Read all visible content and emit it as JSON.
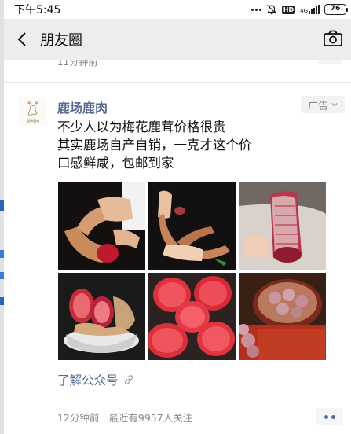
{
  "status_bar": {
    "time": "下午5:45",
    "hd": "HD",
    "network": "4G",
    "battery": "76"
  },
  "nav": {
    "title": "朋友圈",
    "back_icon": "chevron-left-icon",
    "camera_icon": "camera-icon"
  },
  "previous_post": {
    "time": "11分钟前"
  },
  "post": {
    "account_name": "鹿场鹿肉",
    "avatar_text": "鹿场鹿肉",
    "ad_label": "广告",
    "text_lines": [
      "不少人以为梅花鹿茸价格很贵",
      "其实鹿场自产自销，一克才这个价",
      "口感鲜咸，包邮到家"
    ],
    "images": [
      {
        "icon": "antler-held-photo"
      },
      {
        "icon": "antler-hand-photo"
      },
      {
        "icon": "antler-cut-photo"
      },
      {
        "icon": "antler-bowl-photo"
      },
      {
        "icon": "antler-slices-photo"
      },
      {
        "icon": "antler-box-photo"
      }
    ],
    "link_text": "了解公众号",
    "time": "12分钟前",
    "followers": "最近有9957人关注"
  },
  "colors": {
    "link": "#576b95",
    "nav_bg": "#ededed",
    "meta": "#8a8a8a"
  }
}
